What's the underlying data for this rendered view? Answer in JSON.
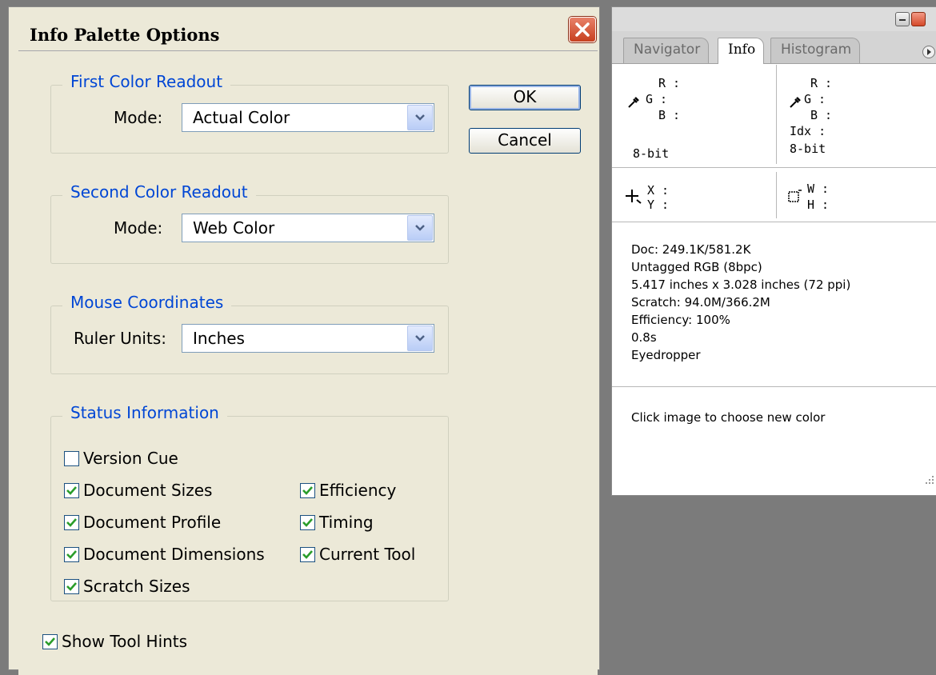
{
  "dialog": {
    "title": "Info Palette Options",
    "ok_label": "OK",
    "cancel_label": "Cancel",
    "first_readout": {
      "legend": "First Color Readout",
      "mode_label": "Mode:",
      "mode_value": "Actual Color"
    },
    "second_readout": {
      "legend": "Second Color Readout",
      "mode_label": "Mode:",
      "mode_value": "Web Color"
    },
    "mouse_coords": {
      "legend": "Mouse Coordinates",
      "units_label": "Ruler Units:",
      "units_value": "Inches"
    },
    "status_info": {
      "legend": "Status Information",
      "items": [
        {
          "label": "Version Cue",
          "checked": false
        },
        {
          "label": "Document Sizes",
          "checked": true
        },
        {
          "label": "Document Profile",
          "checked": true
        },
        {
          "label": "Document Dimensions",
          "checked": true
        },
        {
          "label": "Scratch Sizes",
          "checked": true
        },
        {
          "label": "Efficiency",
          "checked": true
        },
        {
          "label": "Timing",
          "checked": true
        },
        {
          "label": "Current Tool",
          "checked": true
        }
      ]
    },
    "show_tool_hints": {
      "label": "Show Tool Hints",
      "checked": true
    }
  },
  "palette": {
    "tabs": [
      "Navigator",
      "Info",
      "Histogram"
    ],
    "active_tab": "Info",
    "left_readout": {
      "r": "R :",
      "g": "G :",
      "b": "B :",
      "depth": "8-bit"
    },
    "right_readout": {
      "r": "R :",
      "g": "G :",
      "b": "B :",
      "idx": "Idx :",
      "depth": "8-bit"
    },
    "coords": {
      "x": "X :",
      "y": "Y :",
      "w": "W :",
      "h": "H :"
    },
    "status_lines": [
      "Doc: 249.1K/581.2K",
      "Untagged RGB (8bpc)",
      "5.417 inches x 3.028 inches (72 ppi)",
      "Scratch: 94.0M/366.2M",
      "Efficiency: 100%",
      "0.8s",
      "Eyedropper"
    ],
    "hint": "Click image to choose new color"
  },
  "colors": {
    "legend": "#0046d5",
    "check": "#2a9d2a",
    "dialog_bg": "#ece9d8"
  }
}
